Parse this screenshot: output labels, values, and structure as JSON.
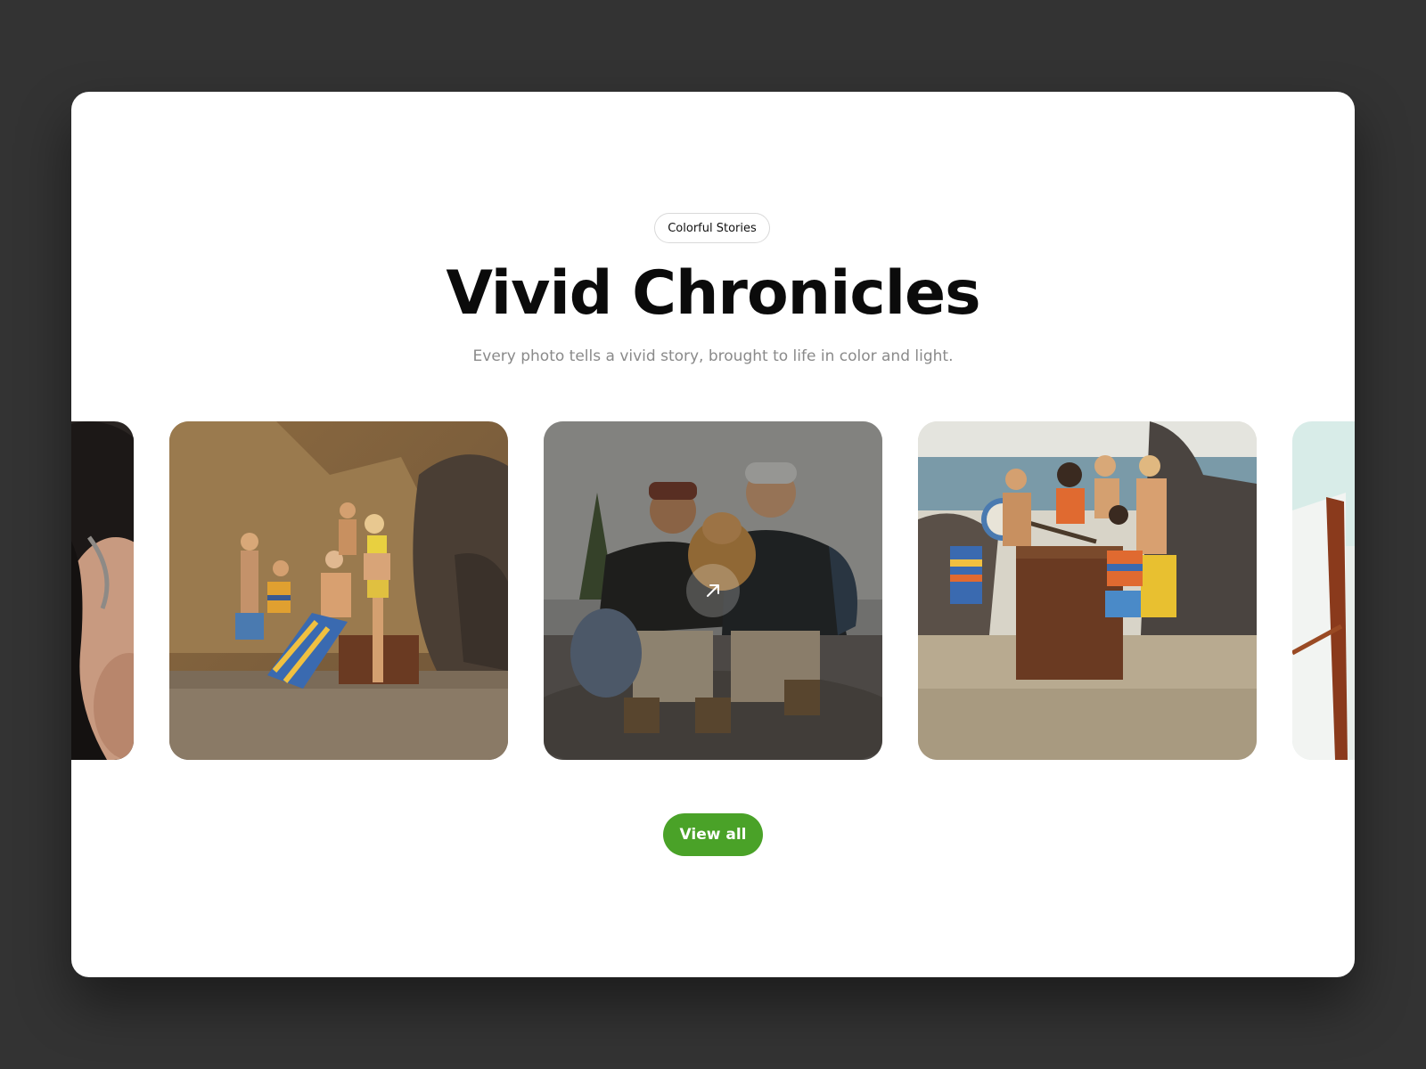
{
  "section": {
    "eyebrow": "Colorful Stories",
    "title": "Vivid Chronicles",
    "subtitle": "Every photo tells a vivid story, brought to life in color and light."
  },
  "gallery": {
    "photos": [
      {
        "alt": "Portrait of a woman with long dark hair",
        "icon": "photo"
      },
      {
        "alt": "Group of young people in striped swimwear around a piano on a rocky beach",
        "icon": "photo"
      },
      {
        "alt": "Two hikers smiling with a golden dog on a rock",
        "icon": "photo",
        "hovered": true
      },
      {
        "alt": "Young men in swimwear playing a piano and banjo on the beach",
        "icon": "photo"
      },
      {
        "alt": "Partial view of a beach scene with a white chair",
        "icon": "photo"
      }
    ],
    "open_icon": "arrow-up-right-icon"
  },
  "actions": {
    "view_all_label": "View all"
  },
  "colors": {
    "page_background": "#333333",
    "card_background": "#ffffff",
    "accent": "#4aa228",
    "title": "#0b0b0b",
    "subtitle": "#8a8a8a"
  }
}
